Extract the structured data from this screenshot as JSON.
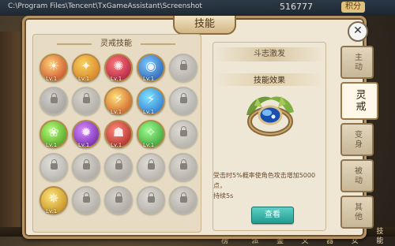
{
  "hud": {
    "path_text": "C:\\Program Files\\Tencent\\TxGameAssistant\\Screenshot",
    "gold": "516777",
    "badge": "积分",
    "bottom_items": [
      "排行榜",
      "帮派",
      "图鉴",
      "符文",
      "神器",
      "仙女",
      "技能"
    ]
  },
  "window": {
    "title": "技能",
    "close_symbol": "✕"
  },
  "left_panel": {
    "header": "灵戒技能",
    "skills": [
      {
        "lv": "Lv.1",
        "locked": false,
        "color1": "#ffd27a",
        "color2": "#c1361a",
        "glyph": "☀"
      },
      {
        "lv": "Lv.1",
        "locked": false,
        "color1": "#f6d35f",
        "color2": "#d4711c",
        "glyph": "✦"
      },
      {
        "lv": "Lv.1",
        "locked": false,
        "color1": "#ff7a7a",
        "color2": "#a0103b",
        "glyph": "✺"
      },
      {
        "lv": "Lv.1",
        "locked": false,
        "color1": "#7ec9ff",
        "color2": "#1d4fa3",
        "glyph": "◉"
      },
      {
        "lv": "",
        "locked": true,
        "color1": "#ddd6c7",
        "color2": "#9b9587",
        "glyph": ""
      },
      {
        "lv": "",
        "locked": true,
        "color1": "#d8c7df",
        "color2": "#8e7a9c",
        "glyph": ""
      },
      {
        "lv": "",
        "locked": true,
        "color1": "#dcd3c3",
        "color2": "#9a9181",
        "glyph": ""
      },
      {
        "lv": "Lv.1",
        "locked": false,
        "color1": "#ffe27a",
        "color2": "#c4481a",
        "glyph": "⚡"
      },
      {
        "lv": "Lv.1",
        "locked": false,
        "color1": "#7fe4ff",
        "color2": "#2264c6",
        "glyph": "⚡"
      },
      {
        "lv": "",
        "locked": true,
        "color1": "#cfdde2",
        "color2": "#7f9aa3",
        "glyph": ""
      },
      {
        "lv": "Lv.1",
        "locked": false,
        "color1": "#b7ff7a",
        "color2": "#3c8d14",
        "glyph": "❀"
      },
      {
        "lv": "Lv.1",
        "locked": false,
        "color1": "#d98bff",
        "color2": "#5b1a9a",
        "glyph": "✹"
      },
      {
        "lv": "Lv.1",
        "locked": false,
        "color1": "#ff8a7a",
        "color2": "#9c1c1c",
        "glyph": "☗"
      },
      {
        "lv": "Lv.1",
        "locked": false,
        "color1": "#9cff8f",
        "color2": "#2e8d2a",
        "glyph": "✧"
      },
      {
        "lv": "",
        "locked": true,
        "color1": "#e4dccb",
        "color2": "#a39985",
        "glyph": ""
      },
      {
        "lv": "",
        "locked": true,
        "color1": "#d7e2e0",
        "color2": "#8ca19c",
        "glyph": ""
      },
      {
        "lv": "",
        "locked": true,
        "color1": "#e3d4cc",
        "color2": "#a18a7e",
        "glyph": ""
      },
      {
        "lv": "",
        "locked": true,
        "color1": "#dfd2c9",
        "color2": "#9d8c80",
        "glyph": ""
      },
      {
        "lv": "",
        "locked": true,
        "color1": "#e8ddd0",
        "color2": "#a89684",
        "glyph": ""
      },
      {
        "lv": "",
        "locked": true,
        "color1": "#e0d7ca",
        "color2": "#9f9384",
        "glyph": ""
      },
      {
        "lv": "Lv.1",
        "locked": false,
        "color1": "#ffe27a",
        "color2": "#b7820f",
        "glyph": "✵"
      },
      {
        "lv": "",
        "locked": true,
        "color1": "#ded4c6",
        "color2": "#9d9182",
        "glyph": ""
      },
      {
        "lv": "",
        "locked": true,
        "color1": "#d7cfc3",
        "color2": "#958b7c",
        "glyph": ""
      },
      {
        "lv": "",
        "locked": true,
        "color1": "#e3d9cc",
        "color2": "#a29585",
        "glyph": ""
      },
      {
        "lv": "",
        "locked": true,
        "color1": "#ddd5c8",
        "color2": "#9a8f80",
        "glyph": ""
      }
    ]
  },
  "detail": {
    "skill_name": "斗志激发",
    "effect_header": "技能效果",
    "description_line1": "受击时5%概率使角色攻击增加5000点，",
    "description_line2": "持续5s",
    "view_button": "查看"
  },
  "tabs": [
    {
      "label": "主动",
      "active": false
    },
    {
      "label": "灵戒",
      "active": true
    },
    {
      "label": "变身",
      "active": false
    },
    {
      "label": "被动",
      "active": false
    },
    {
      "label": "其他",
      "active": false
    }
  ]
}
